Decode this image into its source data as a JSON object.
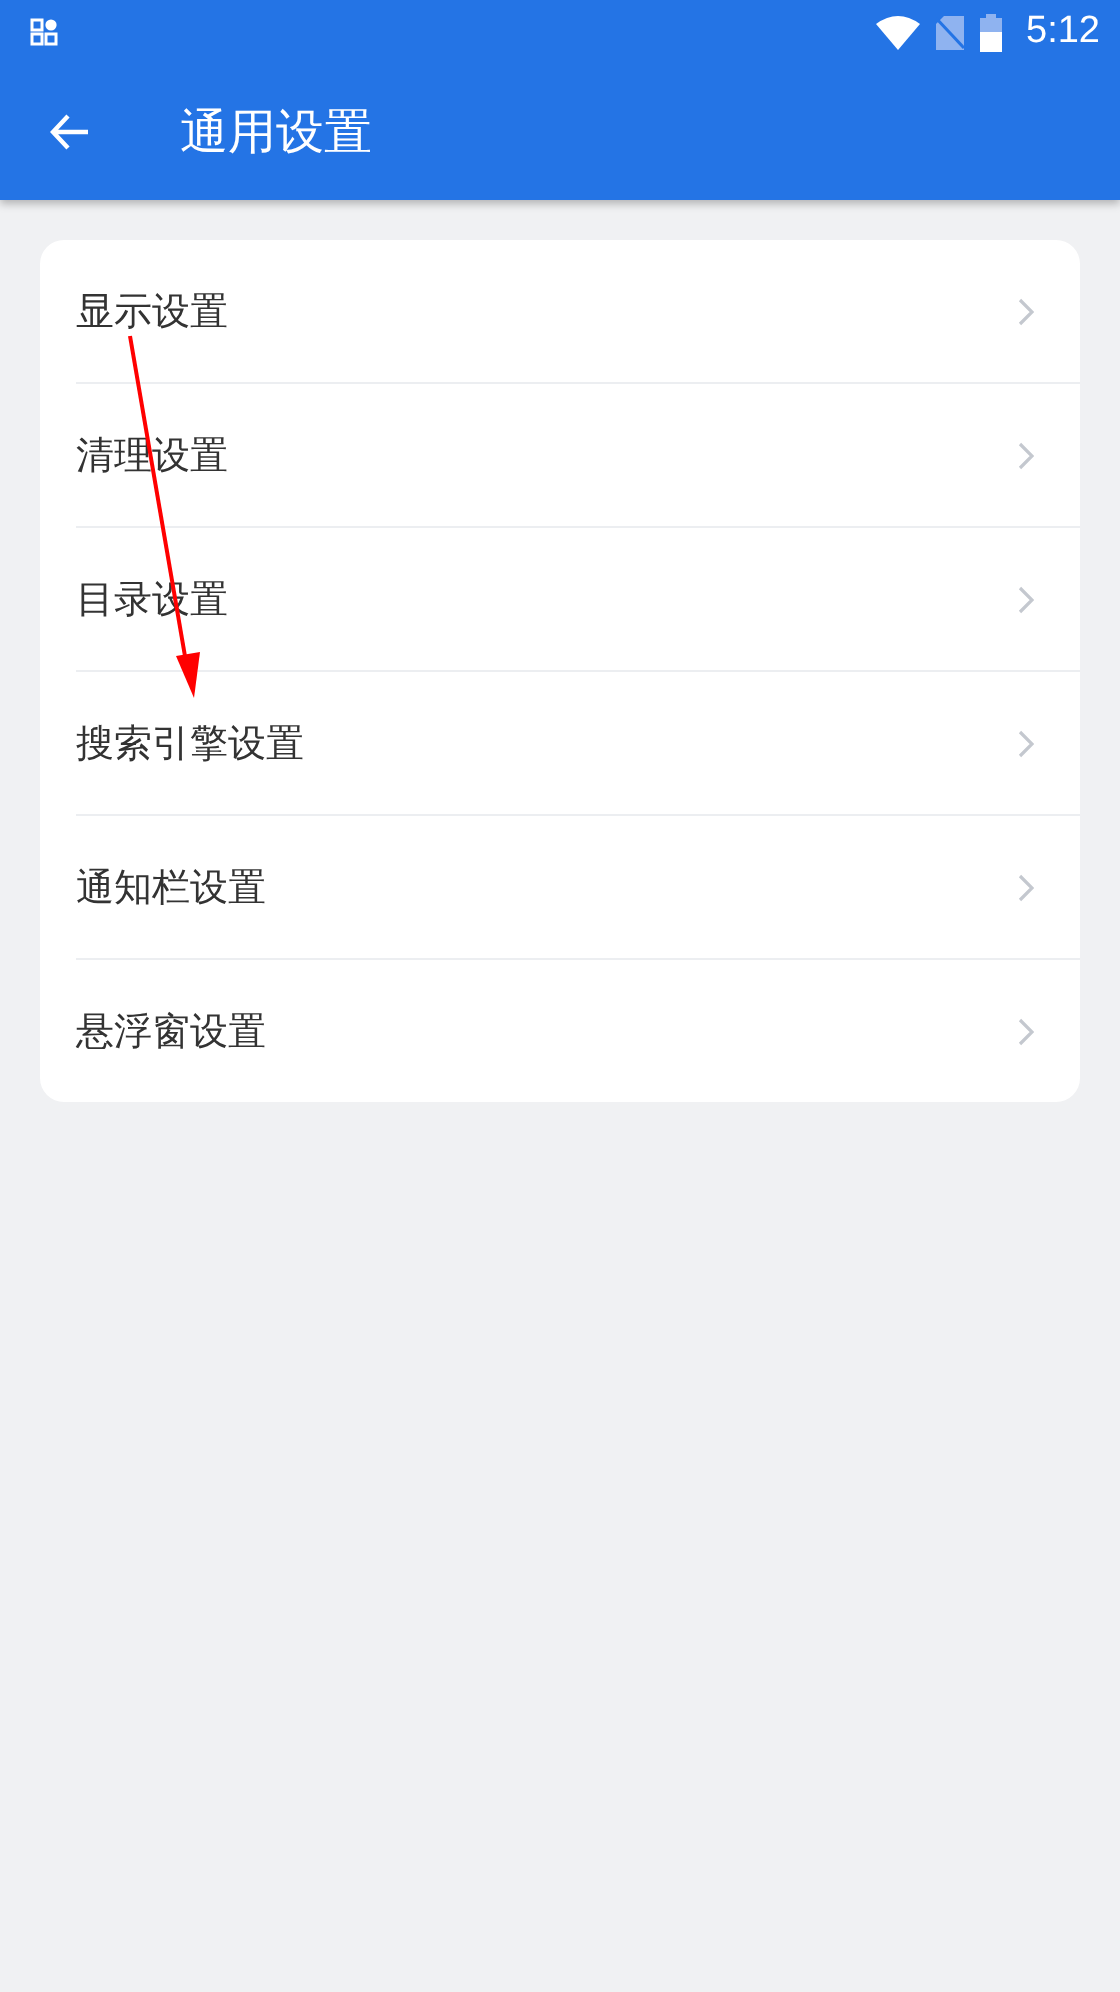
{
  "status_bar": {
    "time": "5:12"
  },
  "app_bar": {
    "title": "通用设置"
  },
  "settings": [
    {
      "label": "显示设置"
    },
    {
      "label": "清理设置"
    },
    {
      "label": "目录设置"
    },
    {
      "label": "搜索引擎设置"
    },
    {
      "label": "通知栏设置"
    },
    {
      "label": "悬浮窗设置"
    }
  ]
}
